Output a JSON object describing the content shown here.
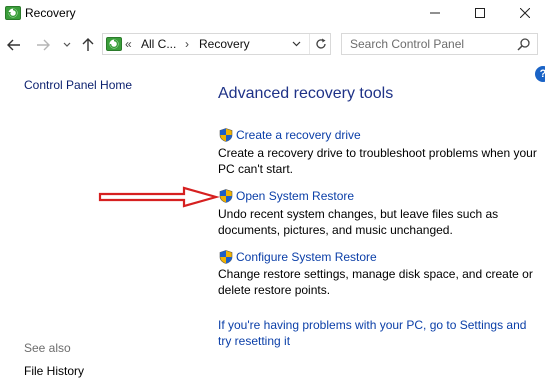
{
  "window": {
    "title": "Recovery"
  },
  "nav": {
    "address_prefix": "«",
    "address_parent": "All C...",
    "address_sep": "›",
    "address_current": "Recovery",
    "search_placeholder": "Search Control Panel"
  },
  "sidebar": {
    "home_label": "Control Panel Home",
    "see_also_label": "See also",
    "file_history_label": "File History"
  },
  "main": {
    "heading": "Advanced recovery tools",
    "tasks": [
      {
        "link": "Create a recovery drive",
        "desc": "Create a recovery drive to troubleshoot problems when your PC can't start."
      },
      {
        "link": "Open System Restore",
        "desc": "Undo recent system changes, but leave files such as documents, pictures, and music unchanged."
      },
      {
        "link": "Configure System Restore",
        "desc": "Change restore settings, manage disk space, and create or delete restore points."
      }
    ],
    "settings_link": "If you're having problems with your PC, go to Settings and try resetting it"
  },
  "colors": {
    "link": "#0b3fa8",
    "heading": "#1e3287",
    "annotation_arrow": "#d62020"
  }
}
